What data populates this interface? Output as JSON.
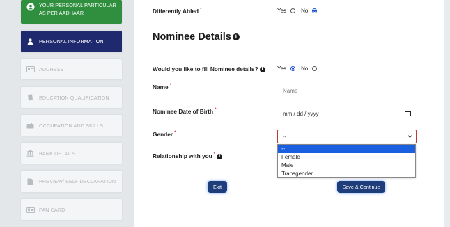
{
  "sidebar": {
    "items": [
      {
        "label": "YOUR PERSONAL PARTICULAR AS PER AADHAAR",
        "icon": "user-circle-icon"
      },
      {
        "label": "PERSONAL INFORMATION",
        "icon": "user-icon"
      },
      {
        "label": "ADDRESS",
        "icon": "id-card-icon"
      },
      {
        "label": "EDUCATION QUALIFICATION",
        "icon": "book-icon"
      },
      {
        "label": "OCCUPATION AND SKILLS",
        "icon": "briefcase-icon"
      },
      {
        "label": "BANK DETAILS",
        "icon": "bank-icon"
      },
      {
        "label": "PREVIEW/ SELF DECLARATION",
        "icon": "document-icon"
      },
      {
        "label": "PAN CARD",
        "icon": "id-card-icon"
      }
    ],
    "colors": {
      "green": "#2f8f3e",
      "active": "#1f2a6e"
    }
  },
  "form": {
    "differently_abled": {
      "label": "Differently Abled",
      "yes": "Yes",
      "no": "No",
      "selected": "No"
    },
    "section_title": "Nominee Details",
    "fill_nominee": {
      "label": "Would you like to fill Nominee details?",
      "yes": "Yes",
      "no": "No",
      "selected": "Yes"
    },
    "name": {
      "label": "Name",
      "placeholder": "Name"
    },
    "dob": {
      "label": "Nominee Date of Birth",
      "placeholder": "mm / dd / yyyy"
    },
    "gender": {
      "label": "Gender",
      "value": "--",
      "options": [
        "--",
        "Female",
        "Male",
        "Transgender"
      ]
    },
    "relationship": {
      "label": "Relationship with you"
    }
  },
  "buttons": {
    "exit": "Exit",
    "save": "Save & Continue"
  }
}
